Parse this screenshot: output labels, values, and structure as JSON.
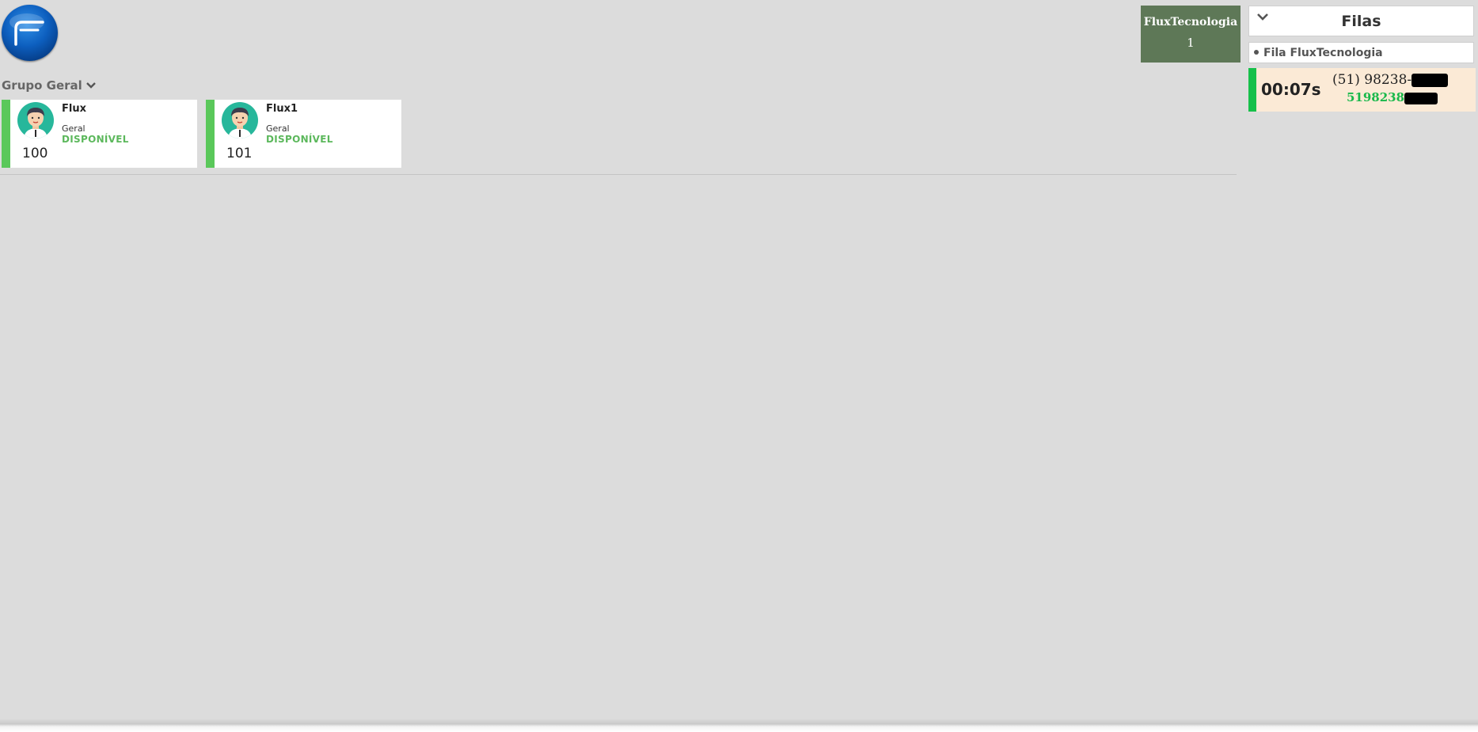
{
  "logo": {
    "icon": "flux-logo-icon"
  },
  "group": {
    "title": "Grupo Geral",
    "icon": "chevron-down-icon"
  },
  "agents": [
    {
      "name": "Flux",
      "group": "Geral",
      "status": "DISPONÍVEL",
      "extension": "100",
      "status_color": "#5cb85c"
    },
    {
      "name": "Flux1",
      "group": "Geral",
      "status": "DISPONÍVEL",
      "extension": "101",
      "status_color": "#5cb85c"
    }
  ],
  "queue_counter": {
    "name": "FluxTecnologia",
    "count": "1",
    "color": "#5e7857"
  },
  "right_panel": {
    "title": "Filas",
    "queues": [
      {
        "label": "Fila FluxTecnologia"
      }
    ],
    "calls": [
      {
        "elapsed": "00:07s",
        "number": "(51) 98238-",
        "sub_number": "5198238",
        "accent": "#16c04a"
      }
    ]
  }
}
